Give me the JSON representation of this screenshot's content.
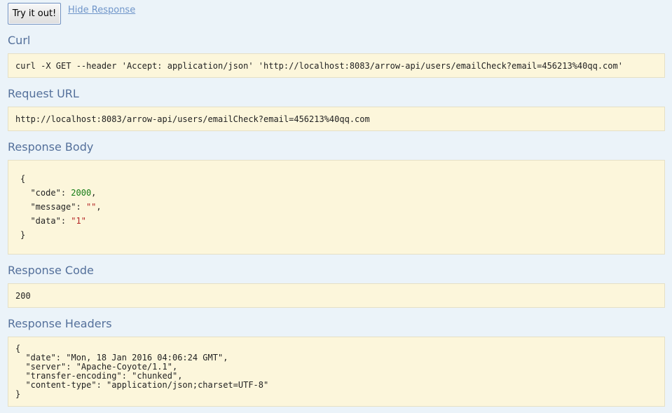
{
  "top": {
    "try_button_label": "Try it out!",
    "hide_link_label": "Hide Response"
  },
  "sections": {
    "curl": {
      "heading": "Curl",
      "text": "curl -X GET --header 'Accept: application/json' 'http://localhost:8083/arrow-api/users/emailCheck?email=456213%40qq.com'"
    },
    "request_url": {
      "heading": "Request URL",
      "text": "http://localhost:8083/arrow-api/users/emailCheck?email=456213%40qq.com"
    },
    "response_body": {
      "heading": "Response Body",
      "open_brace": "{",
      "lines": [
        {
          "key": "\"code\"",
          "sep": ": ",
          "value": "2000",
          "tail": ","
        },
        {
          "key": "\"message\"",
          "sep": ": ",
          "value": "\"\"",
          "tail": ","
        },
        {
          "key": "\"data\"",
          "sep": ": ",
          "value": "\"1\"",
          "tail": ""
        }
      ],
      "close_brace": "}"
    },
    "response_code": {
      "heading": "Response Code",
      "text": "200"
    },
    "response_headers": {
      "heading": "Response Headers",
      "text": "{\n  \"date\": \"Mon, 18 Jan 2016 04:06:24 GMT\",\n  \"server\": \"Apache-Coyote/1.1\",\n  \"transfer-encoding\": \"chunked\",\n  \"content-type\": \"application/json;charset=UTF-8\"\n}"
    }
  },
  "colors": {
    "background": "#ebf3f9",
    "heading": "#54709b",
    "link": "#6f95c9",
    "code_background": "#fcf6db",
    "json_number": "#137b13",
    "json_string": "#b32424"
  }
}
